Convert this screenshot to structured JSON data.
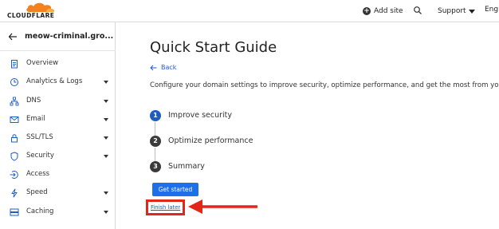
{
  "topbar": {
    "logo_text": "CLOUDFLARE",
    "add_site": "Add site",
    "support": "Support",
    "language": "Engl"
  },
  "sidebar": {
    "site_name": "meow-criminal.gro...",
    "items": [
      {
        "label": "Overview",
        "icon": "clipboard-icon",
        "has_caret": false
      },
      {
        "label": "Analytics & Logs",
        "icon": "clock-chart-icon",
        "has_caret": true
      },
      {
        "label": "DNS",
        "icon": "network-icon",
        "has_caret": true
      },
      {
        "label": "Email",
        "icon": "envelope-icon",
        "has_caret": true
      },
      {
        "label": "SSL/TLS",
        "icon": "lock-icon",
        "has_caret": true
      },
      {
        "label": "Security",
        "icon": "shield-icon",
        "has_caret": true
      },
      {
        "label": "Access",
        "icon": "login-icon",
        "has_caret": false
      },
      {
        "label": "Speed",
        "icon": "bolt-icon",
        "has_caret": true
      },
      {
        "label": "Caching",
        "icon": "server-icon",
        "has_caret": true
      }
    ]
  },
  "main": {
    "title": "Quick Start Guide",
    "back_label": "Back",
    "intro": "Configure your domain settings to improve security, optimize performance, and get the most from your a",
    "steps": [
      {
        "num": "1",
        "label": "Improve security",
        "active": true
      },
      {
        "num": "2",
        "label": "Optimize performance",
        "active": false
      },
      {
        "num": "3",
        "label": "Summary",
        "active": false
      }
    ],
    "get_started": "Get started",
    "finish_later": "Finish later"
  },
  "colors": {
    "brand_orange": "#f48120",
    "link_blue": "#1a5bd1",
    "primary_button": "#1f6feb",
    "step_active": "#1f5cc4",
    "step_inactive": "#3b3b3b",
    "annotation_red": "#e0271a"
  }
}
